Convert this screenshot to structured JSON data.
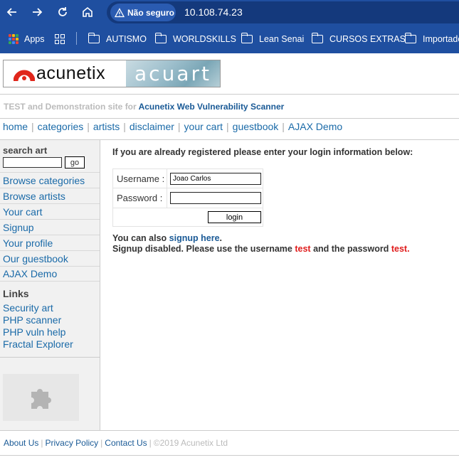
{
  "browser": {
    "security_label": "Não seguro",
    "url": "10.108.74.23",
    "bookmarks": {
      "apps": "Apps",
      "items": [
        "AUTISMO",
        "WORLDSKILLS",
        "Lean Senai",
        "CURSOS EXTRAS",
        "Importado"
      ]
    }
  },
  "logo": {
    "brand": "acunetix",
    "site": "acuart"
  },
  "tagline": {
    "prefix": "TEST and Demonstration site for",
    "link": "Acunetix Web Vulnerability Scanner"
  },
  "nav": {
    "items": [
      "home",
      "categories",
      "artists",
      "disclaimer",
      "your cart",
      "guestbook",
      "AJAX Demo"
    ]
  },
  "sidebar": {
    "search_label": "search art",
    "go_label": "go",
    "menu": [
      "Browse categories",
      "Browse artists",
      "Your cart",
      "Signup",
      "Your profile",
      "Our guestbook",
      "AJAX Demo"
    ],
    "links_title": "Links",
    "links": [
      "Security art",
      "PHP scanner",
      "PHP vuln help",
      "Fractal Explorer"
    ]
  },
  "main": {
    "intro": "If you are already registered please enter your login information below:",
    "username_label": "Username :",
    "username_value": "Joao Carlos",
    "password_label": "Password :",
    "login_button": "login",
    "signup_prefix": "You can also",
    "signup_link": "signup here",
    "signup_suffix": ".",
    "disabled_prefix": "Signup disabled. Please use the username",
    "test_user": "test",
    "disabled_mid": "and the password",
    "test_pass": "test",
    "disabled_suffix": "."
  },
  "footer": {
    "about": "About Us",
    "privacy": "Privacy Policy",
    "contact": "Contact Us",
    "copyright": "©2019 Acunetix Ltd"
  },
  "colors": {
    "chrome": "#1f4fa0",
    "link": "#1a6aa8",
    "warning_red": "#e01b1b"
  }
}
